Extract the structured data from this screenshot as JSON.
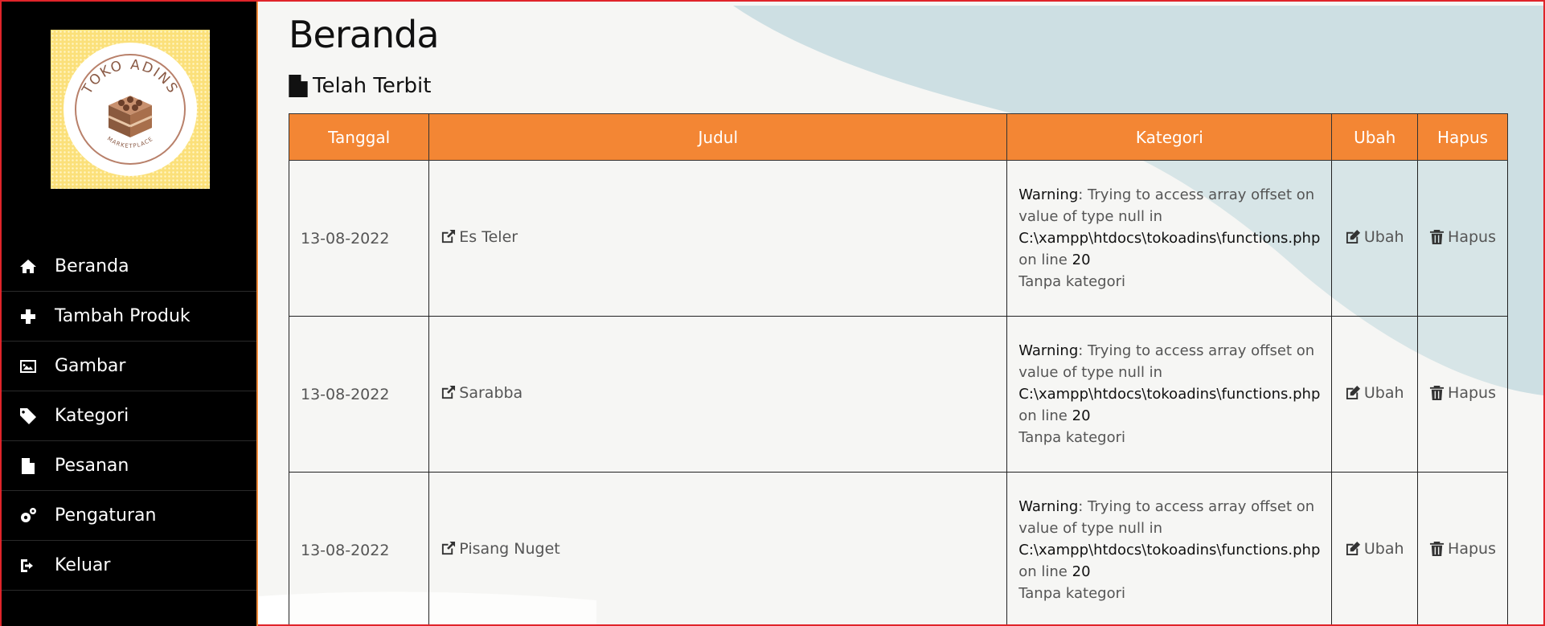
{
  "sidebar": {
    "logo": {
      "title": "TOKO ADINS",
      "subtitle": "MARKETPLACE"
    },
    "items": [
      {
        "label": "Beranda",
        "icon": "home-icon"
      },
      {
        "label": "Tambah Produk",
        "icon": "plus-icon"
      },
      {
        "label": "Gambar",
        "icon": "image-icon"
      },
      {
        "label": "Kategori",
        "icon": "tag-icon"
      },
      {
        "label": "Pesanan",
        "icon": "file-text-icon"
      },
      {
        "label": "Pengaturan",
        "icon": "gears-icon"
      },
      {
        "label": "Keluar",
        "icon": "sign-out-icon"
      }
    ]
  },
  "main": {
    "title": "Beranda",
    "section_title": "Telah Terbit",
    "table": {
      "headers": [
        "Tanggal",
        "Judul",
        "Kategori",
        "Ubah",
        "Hapus"
      ],
      "rows": [
        {
          "date": "13-08-2022",
          "title": "Es Teler",
          "warning_label": "Warning",
          "warning_text": ": Trying to access array offset on value of type null in",
          "warning_path": "C:\\xampp\\htdocs\\tokoadins\\functions.php",
          "warning_line_prefix": "on line",
          "warning_line": "20",
          "category": "Tanpa kategori",
          "edit": "Ubah",
          "delete": "Hapus"
        },
        {
          "date": "13-08-2022",
          "title": "Sarabba",
          "warning_label": "Warning",
          "warning_text": ": Trying to access array offset on value of type null in",
          "warning_path": "C:\\xampp\\htdocs\\tokoadins\\functions.php",
          "warning_line_prefix": "on line",
          "warning_line": "20",
          "category": "Tanpa kategori",
          "edit": "Ubah",
          "delete": "Hapus"
        },
        {
          "date": "13-08-2022",
          "title": "Pisang Nuget",
          "warning_label": "Warning",
          "warning_text": ": Trying to access array offset on value of type null in",
          "warning_path": "C:\\xampp\\htdocs\\tokoadins\\functions.php",
          "warning_line_prefix": "on line",
          "warning_line": "20",
          "category": "Tanpa kategori",
          "edit": "Ubah",
          "delete": "Hapus"
        }
      ]
    }
  },
  "colors": {
    "sidebar_bg": "#000000",
    "accent": "#f38634",
    "bg_shape": "#cddfe3",
    "border_red": "#e0242a"
  }
}
